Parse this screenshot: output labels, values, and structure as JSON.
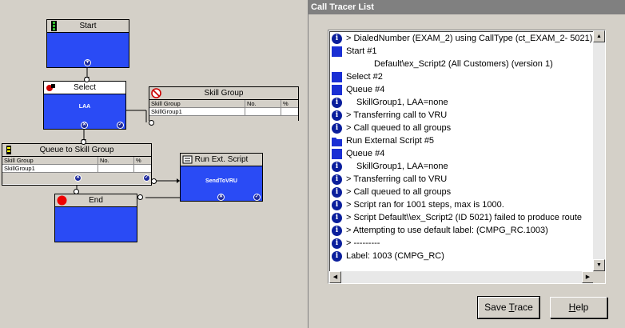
{
  "flow": {
    "start": {
      "title": "Start"
    },
    "select": {
      "title": "Select",
      "body": "LAA"
    },
    "skill_group": {
      "title": "Skill Group",
      "cols": [
        "Skill Group",
        "No.",
        "%"
      ],
      "rows": [
        "SkillGroup1"
      ]
    },
    "queue": {
      "title": "Queue to Skill Group",
      "cols": [
        "Skill Group",
        "No.",
        "%"
      ],
      "rows": [
        "SkillGroup1"
      ]
    },
    "run_script": {
      "title": "Run Ext. Script",
      "body": "SendToVRU"
    },
    "end": {
      "title": "End"
    }
  },
  "tracer": {
    "title": "Call Tracer List",
    "items": [
      {
        "icon": "info",
        "text": "> DialedNumber (EXAM_2) using CallType (ct_EXAM_2- 5021)",
        "indent": 0
      },
      {
        "icon": "square",
        "text": "Start #1",
        "indent": 0
      },
      {
        "icon": "none",
        "text": "Default\\ex_Script2 (All Customers) (version 1)",
        "indent": 1
      },
      {
        "icon": "square",
        "text": "Select #2",
        "indent": 0
      },
      {
        "icon": "square",
        "text": "Queue #4",
        "indent": 0
      },
      {
        "icon": "info",
        "text": "SkillGroup1, LAA=none",
        "indent": 2
      },
      {
        "icon": "info",
        "text": "> Transferring call to VRU",
        "indent": 0
      },
      {
        "icon": "info",
        "text": "> Call queued to all groups",
        "indent": 0
      },
      {
        "icon": "folder",
        "text": "Run External Script #5",
        "indent": 0
      },
      {
        "icon": "square",
        "text": "Queue #4",
        "indent": 0
      },
      {
        "icon": "info",
        "text": "SkillGroup1, LAA=none",
        "indent": 2
      },
      {
        "icon": "info",
        "text": "> Transferring call to VRU",
        "indent": 0
      },
      {
        "icon": "info",
        "text": "> Call queued to all groups",
        "indent": 0
      },
      {
        "icon": "info",
        "text": "> Script ran for 1001 steps, max is 1000.",
        "indent": 0
      },
      {
        "icon": "info",
        "text": "> Script Default\\\\ex_Script2 (ID 5021) failed to produce route",
        "indent": 0
      },
      {
        "icon": "info",
        "text": "> Attempting to use default label: (CMPG_RC.1003)",
        "indent": 0
      },
      {
        "icon": "info",
        "text": "> ---------",
        "indent": 0
      },
      {
        "icon": "info",
        "text": "Label: 1003 (CMPG_RC)",
        "indent": 0
      }
    ],
    "save_trace_label": "Save Trace",
    "save_trace_accel": "T",
    "help_label": "Help",
    "help_accel": "H"
  },
  "colors": {
    "node_blue": "#2a4bf5",
    "info_blue": "#0a1e9c",
    "title_bar": "#808080",
    "face": "#d4d0c8"
  }
}
